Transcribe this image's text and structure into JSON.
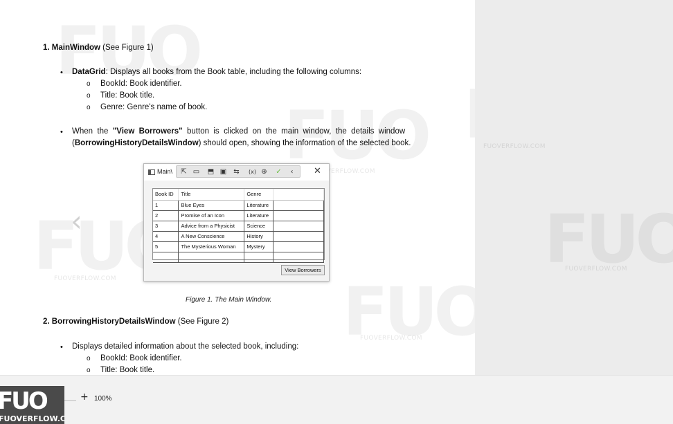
{
  "section1": {
    "number": "1.",
    "title": "MainWindow",
    "ref": "(See Figure 1)",
    "bullets": [
      {
        "term": "DataGrid",
        "text": ": Displays all books from the Book table, including the following columns:"
      }
    ],
    "sub_items": [
      "BookId: Book identifier.",
      "Title: Book title.",
      "Genre: Genre's name of book."
    ],
    "bullet2": {
      "line1_pre": "When  the  ",
      "line1_term": "\"View  Borrowers\"",
      "line1_post": "  button  is  clicked  on  the  main  window,  the  details  window",
      "line2_pre": "(",
      "line2_term": "BorrowingHistoryDetailsWindow",
      "line2_post": ") should open, showing the information of the selected book."
    }
  },
  "figure1": {
    "window_title": "Main\\",
    "columns": [
      "Book ID",
      "Title",
      "Genre",
      ""
    ],
    "rows": [
      [
        "1",
        "Blue Eyes",
        "Literature",
        ""
      ],
      [
        "2",
        "Promise of an Icon",
        "Literature",
        ""
      ],
      [
        "3",
        "Advice from a Physicist",
        "Science",
        ""
      ],
      [
        "4",
        "A New Conscience",
        "History",
        ""
      ],
      [
        "5",
        "The Mysterious Woman",
        "Mystery",
        ""
      ],
      [
        "",
        "",
        "",
        ""
      ]
    ],
    "button_label": "View Borrowers",
    "caption": "Figure 1. The Main Window.",
    "toolbar_icons": [
      "select-element-icon",
      "display-layout-icon",
      "track-focus-icon",
      "layout-adorner-icon",
      "hot-reload-icon",
      "binding-failures-icon",
      "accessibility-icon",
      "check-icon",
      "collapse-icon"
    ]
  },
  "section2": {
    "number": "2.",
    "title": "BorrowingHistoryDetailsWindow",
    "ref": "(See Figure 2)",
    "bullet": "Displays detailed information about the selected book, including:",
    "sub_items": [
      "BookId: Book identifier.",
      "Title: Book title."
    ]
  },
  "zoom": {
    "plus": "+",
    "value": "100%"
  },
  "logo": {
    "text": "FUO",
    "sub": "FUOVERFLOW.COM"
  },
  "watermark": {
    "text": "FUO",
    "site": "FUOVERFLOW.COM"
  },
  "colors": {
    "side_panel": "#ececec",
    "bottom_bar": "#f2f2f2",
    "logo_bg": "#4a4a4a"
  }
}
